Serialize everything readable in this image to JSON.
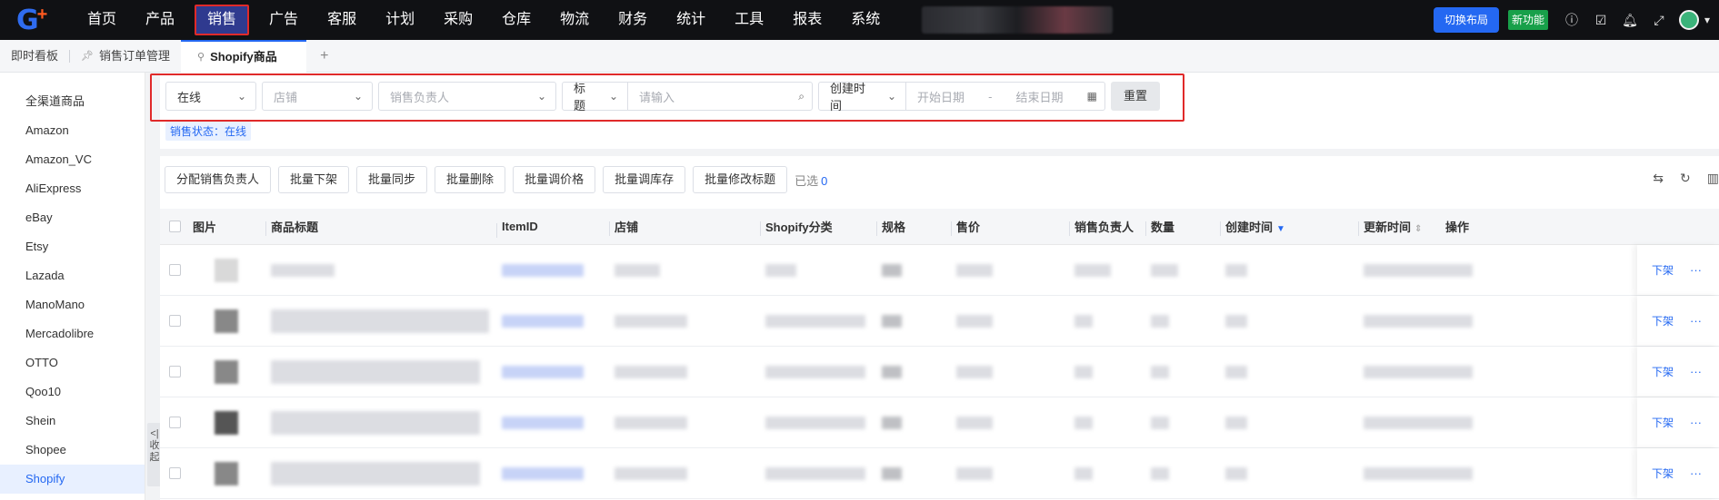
{
  "app": {
    "logo_text": "G",
    "logo_plus": "+"
  },
  "topnav": {
    "items": [
      "首页",
      "产品",
      "销售",
      "广告",
      "客服",
      "计划",
      "采购",
      "仓库",
      "物流",
      "财务",
      "统计",
      "工具",
      "报表",
      "系统"
    ],
    "active_index": 2,
    "switch_layout_label": "切换布局",
    "new_feature_label": "新功能"
  },
  "tabs": {
    "items": [
      {
        "label": "即时看板"
      },
      {
        "label": "销售订单管理"
      },
      {
        "label": "Shopify商品"
      }
    ],
    "add_label": "+"
  },
  "sidebar": {
    "items": [
      "全渠道商品",
      "Amazon",
      "Amazon_VC",
      "AliExpress",
      "eBay",
      "Etsy",
      "Lazada",
      "ManoMano",
      "Mercadolibre",
      "OTTO",
      "Qoo10",
      "Shein",
      "Shopee",
      "Shopify"
    ],
    "active_index": 13,
    "collapse_label": "<| 收起"
  },
  "filters": {
    "status_value": "在线",
    "shop_placeholder": "店铺",
    "owner_placeholder": "销售负责人",
    "title_field": "标题",
    "title_placeholder": "请输入",
    "date_field": "创建时间",
    "start_placeholder": "开始日期",
    "date_sep": "-",
    "end_placeholder": "结束日期",
    "reset_label": "重置",
    "status_tag": "销售状态：在线"
  },
  "toolbar": {
    "buttons": [
      "分配销售负责人",
      "批量下架",
      "批量同步",
      "批量删除",
      "批量调价格",
      "批量调库存",
      "批量修改标题"
    ],
    "selected_prefix": "已选",
    "selected_count": "0"
  },
  "table": {
    "columns": [
      "图片",
      "商品标题",
      "ItemID",
      "店铺",
      "Shopify分类",
      "规格",
      "售价",
      "销售负责人",
      "数量",
      "创建时间",
      "更新时间",
      "操作"
    ],
    "row_action": "下架",
    "row_more": "···",
    "row_count": 5
  },
  "colors": {
    "accent": "#2468f2",
    "highlight": "#e02a2a",
    "nav_bg": "#101114"
  }
}
